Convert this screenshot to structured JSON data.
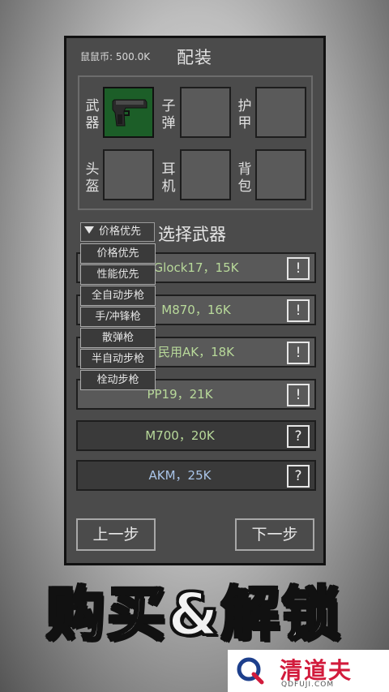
{
  "header": {
    "currency": "鼠鼠币: 500.0K",
    "title": "配装"
  },
  "equipment": {
    "slots": [
      {
        "label": "武器",
        "icon": "pistol-icon",
        "filled": true
      },
      {
        "label": "子弹",
        "filled": false
      },
      {
        "label": "护甲",
        "filled": false
      },
      {
        "label": "头盔",
        "filled": false
      },
      {
        "label": "耳机",
        "filled": false
      },
      {
        "label": "背包",
        "filled": false
      }
    ]
  },
  "weapon_select": {
    "title": "选择武器",
    "sort_selected": "价格优先",
    "sort_options": [
      "价格优先",
      "性能优先",
      "全自动步枪",
      "手/冲锋枪",
      "散弹枪",
      "半自动步枪",
      "栓动步枪"
    ],
    "weapons": [
      {
        "name": "Glock17，15K",
        "status": "!",
        "color": "#b8d99a",
        "locked": false
      },
      {
        "name": "M870，16K",
        "status": "!",
        "color": "#b8d99a",
        "locked": false
      },
      {
        "name": "民用AK，18K",
        "status": "!",
        "color": "#b8d99a",
        "locked": false
      },
      {
        "name": "PP19，21K",
        "status": "!",
        "color": "#b8d99a",
        "locked": false
      },
      {
        "name": "M700，20K",
        "status": "?",
        "color": "#b8d99a",
        "locked": true
      },
      {
        "name": "AKM，25K",
        "status": "?",
        "color": "#a9c4e8",
        "locked": true
      }
    ]
  },
  "navigation": {
    "prev": "上一步",
    "next": "下一步"
  },
  "banner": {
    "text": "购买&解锁"
  },
  "watermark": {
    "title": "清道夫",
    "url": "QDFUJI.COM"
  }
}
